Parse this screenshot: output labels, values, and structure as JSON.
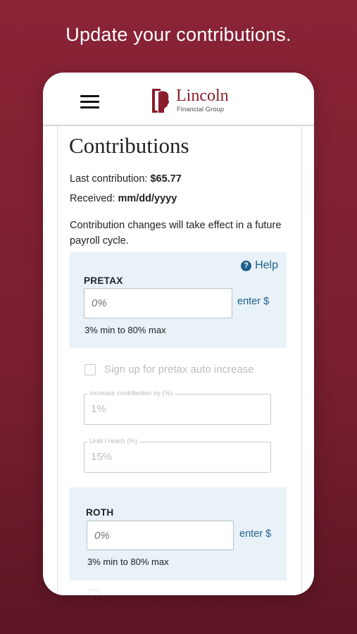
{
  "headline": "Update your contributions.",
  "brand": {
    "name": "Lincoln",
    "sub": "Financial Group"
  },
  "colors": {
    "background": "#7a1f30",
    "brand": "#8a1d2b",
    "link": "#1e5f8a",
    "panel": "#e8f2f8"
  },
  "page": {
    "title": "Contributions",
    "last_contribution_label": "Last contribution:",
    "last_contribution_value": "$65.77",
    "received_label": "Received:",
    "received_value": "mm/dd/yyyy",
    "note": "Contribution changes will take effect in a future payroll cycle."
  },
  "help": {
    "label": "Help",
    "icon": "help-circle-icon"
  },
  "pretax": {
    "label": "PRETAX",
    "placeholder": "0%",
    "enter_dollar": "enter $",
    "range": "3% min to 80% max"
  },
  "auto_increase": {
    "checkbox_label": "Sign up for pretax auto increase",
    "checked": false,
    "increase_label": "Increase contribution by (%)",
    "increase_value": "1%",
    "until_label": "Until I reach (%)",
    "until_value": "15%"
  },
  "roth": {
    "label": "ROTH",
    "placeholder": "0%",
    "enter_dollar": "enter $",
    "range": "3% min to 80% max"
  }
}
